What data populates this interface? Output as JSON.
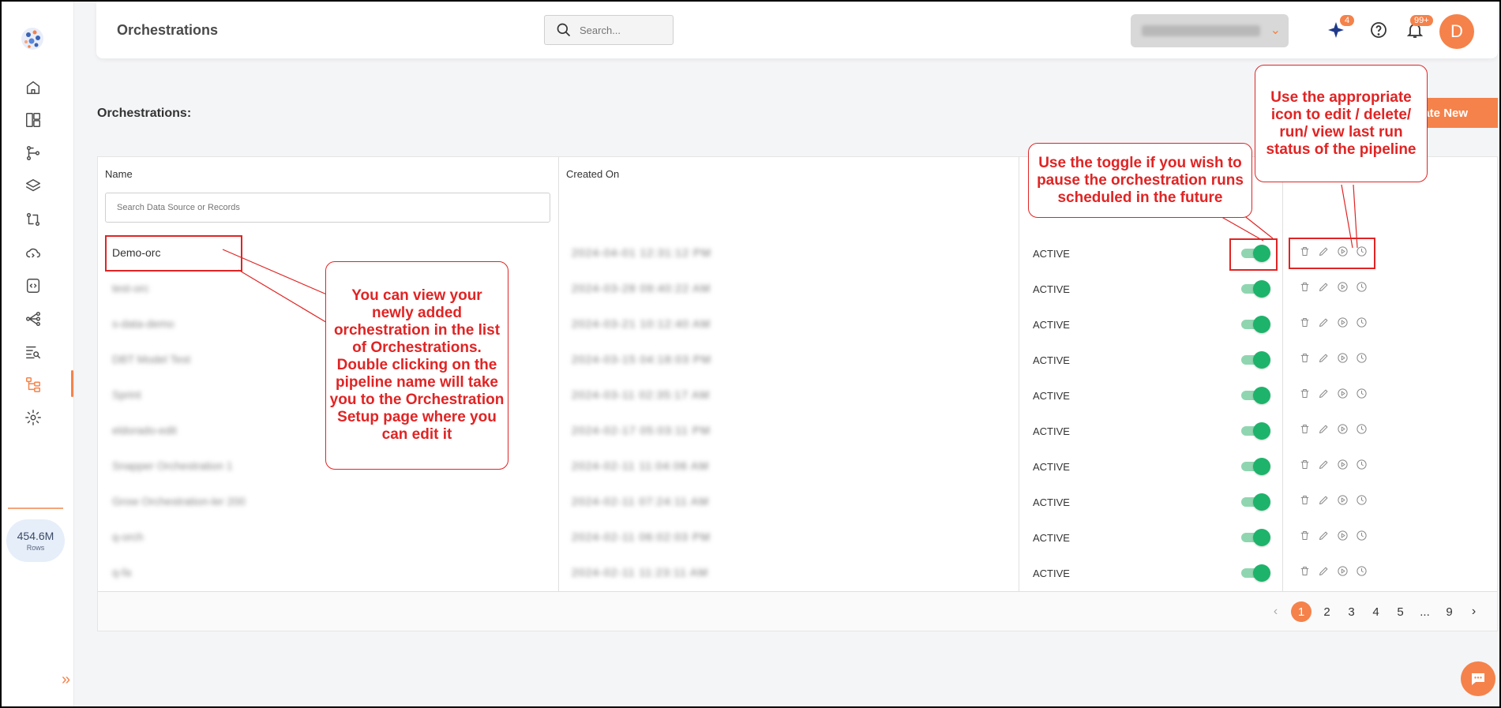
{
  "header": {
    "title": "Orchestrations",
    "search_placeholder": "Search...",
    "sparkle_badge": "4",
    "notifications_badge": "99+",
    "avatar_initial": "D"
  },
  "sidebar": {
    "rows_value": "454.6M",
    "rows_label": "Rows"
  },
  "section": {
    "title": "Orchestrations:",
    "create_button": "eate New"
  },
  "table": {
    "col_name": "Name",
    "col_created": "Created On",
    "filter_placeholder": "Search Data Source or Records",
    "rows": [
      {
        "name": "Demo-orc",
        "created": "2024-04-01 12:31:12 PM",
        "status": "ACTIVE"
      },
      {
        "name": "test-orc",
        "created": "2024-03-28 09:40:22 AM",
        "status": "ACTIVE"
      },
      {
        "name": "s-data-demo",
        "created": "2024-03-21 10:12:40 AM",
        "status": "ACTIVE"
      },
      {
        "name": "DBT Model Test",
        "created": "2024-03-15 04:18:03 PM",
        "status": "ACTIVE"
      },
      {
        "name": "Sprint",
        "created": "2024-03-11 02:35:17 AM",
        "status": "ACTIVE"
      },
      {
        "name": "eldorado-edit",
        "created": "2024-02-17 05:03:11 PM",
        "status": "ACTIVE"
      },
      {
        "name": "Snapper Orchestration 1",
        "created": "2024-02-11 11:04:06 AM",
        "status": "ACTIVE"
      },
      {
        "name": "Grow Orchestration-ler 200",
        "created": "2024-02-11 07:24:11 AM",
        "status": "ACTIVE"
      },
      {
        "name": "q-orch",
        "created": "2024-02-11 06:02:03 PM",
        "status": "ACTIVE"
      },
      {
        "name": "q-fa",
        "created": "2024-02-11 11:23:11 AM",
        "status": "ACTIVE"
      }
    ]
  },
  "pagination": {
    "pages": [
      "1",
      "2",
      "3",
      "4",
      "5",
      "...",
      "9"
    ],
    "current": "1"
  },
  "callouts": {
    "list": "You can view your newly added orchestration in the list of Orchestrations. Double clicking on the pipeline name will take you to the Orchestration Setup page where you can edit it",
    "toggle": "Use the toggle if you wish to pause the orchestration runs scheduled in the future",
    "icons": "Use the appropriate icon to edit / delete/ run/ view last run status of the pipeline"
  },
  "colors": {
    "accent": "#f5824a",
    "toggle_on": "#1db36b",
    "annotation": "#e02424"
  }
}
